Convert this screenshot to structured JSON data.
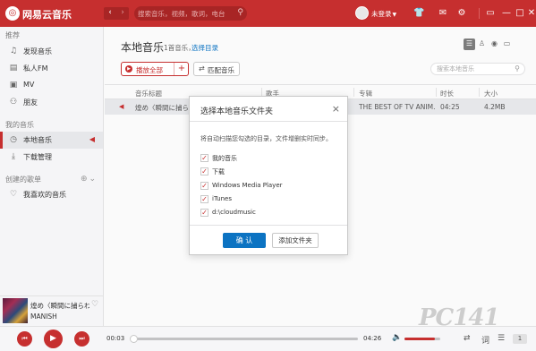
{
  "app": {
    "name": "网易云音乐",
    "logo_icon": "netease-logo-icon"
  },
  "titlebar": {
    "back_glyph": "‹",
    "forward_glyph": "›",
    "search_placeholder": "搜索音乐，视频，歌词，电台",
    "login_text": "未登录",
    "icons": [
      "tshirt-icon",
      "mail-icon",
      "settings-icon",
      "minimode-icon",
      "minimize-icon",
      "maximize-icon",
      "close-icon"
    ]
  },
  "sidebar": {
    "sections": {
      "recommend": "推荐",
      "my_music": "我的音乐",
      "playlists": "创建的歌单"
    },
    "recommend_items": [
      {
        "label": "发现音乐",
        "icon": "music-note-icon"
      },
      {
        "label": "私人FM",
        "icon": "radio-icon"
      },
      {
        "label": "MV",
        "icon": "video-icon"
      },
      {
        "label": "朋友",
        "icon": "friends-icon"
      }
    ],
    "my_music_items": [
      {
        "label": "本地音乐",
        "icon": "local-music-icon",
        "active": true
      },
      {
        "label": "下载管理",
        "icon": "download-icon"
      }
    ],
    "playlist_items": [
      {
        "label": "我喜欢的音乐",
        "icon": "heart-icon"
      }
    ]
  },
  "now_playing": {
    "title": "煌め〈瞬間に捕らわれて",
    "artist": "MANISH"
  },
  "main": {
    "title": "本地音乐",
    "song_count": "1首音乐，",
    "choose_dir": "选择目录",
    "play_all": "播放全部",
    "add_glyph": "+",
    "match": "匹配音乐",
    "search_placeholder": "搜索本地音乐",
    "columns": [
      "音乐标题",
      "歌手",
      "专辑",
      "时长",
      "大小"
    ],
    "rows": [
      {
        "title": "煌め〈瞬間に捕ら",
        "artist": "",
        "album": "THE BEST OF TV ANIM...",
        "duration": "04:25",
        "size": "4.2MB"
      }
    ]
  },
  "dialog": {
    "title": "选择本地音乐文件夹",
    "close_glyph": "×",
    "description": "将自动扫描您勾选的目录，文件增删实时同步。",
    "folders": [
      {
        "label": "我的音乐",
        "checked": true
      },
      {
        "label": "下载",
        "checked": true
      },
      {
        "label": "Windows Media Player",
        "checked": true
      },
      {
        "label": "iTunes",
        "checked": true
      },
      {
        "label": "d:\\cloudmusic",
        "checked": true
      }
    ],
    "ok_label": "确 认",
    "add_folder_label": "添加文件夹"
  },
  "player": {
    "current_time": "00:03",
    "total_time": "04:26",
    "progress_fraction": 0.012,
    "volume_fraction": 0.85,
    "playlist_count": "1"
  },
  "watermark": "PC141",
  "colors": {
    "accent": "#c62f2f",
    "link": "#0c73c2"
  }
}
